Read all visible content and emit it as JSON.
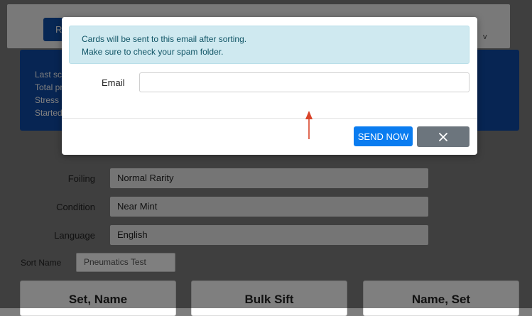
{
  "background": {
    "header_button_label": "RR",
    "top_right_letter": "v",
    "stats_lines": [
      "Last sc",
      "Total pr",
      "Stress",
      "Started"
    ],
    "form": {
      "foiling": {
        "label": "Foiling",
        "value": "Normal Rarity"
      },
      "condition": {
        "label": "Condition",
        "value": "Near Mint"
      },
      "language": {
        "label": "Language",
        "value": "English"
      }
    },
    "sort_name": {
      "label": "Sort Name",
      "value": "Pneumatics Test"
    },
    "sort_cards": [
      "Set, Name",
      "Bulk Sift",
      "Name, Set"
    ]
  },
  "modal": {
    "info_line1": "Cards will be sent to this email after sorting.",
    "info_line2": "Make sure to check your spam folder.",
    "email_label": "Email",
    "email_value": "",
    "send_button_label": "SEND NOW",
    "close_icon": "close-icon"
  },
  "colors": {
    "primary": "#0a7cf0",
    "brand_blue": "#0e4aa6",
    "secondary": "#6c757d",
    "alert_bg": "#cfe9f0",
    "annotation_arrow": "#d9442a"
  }
}
